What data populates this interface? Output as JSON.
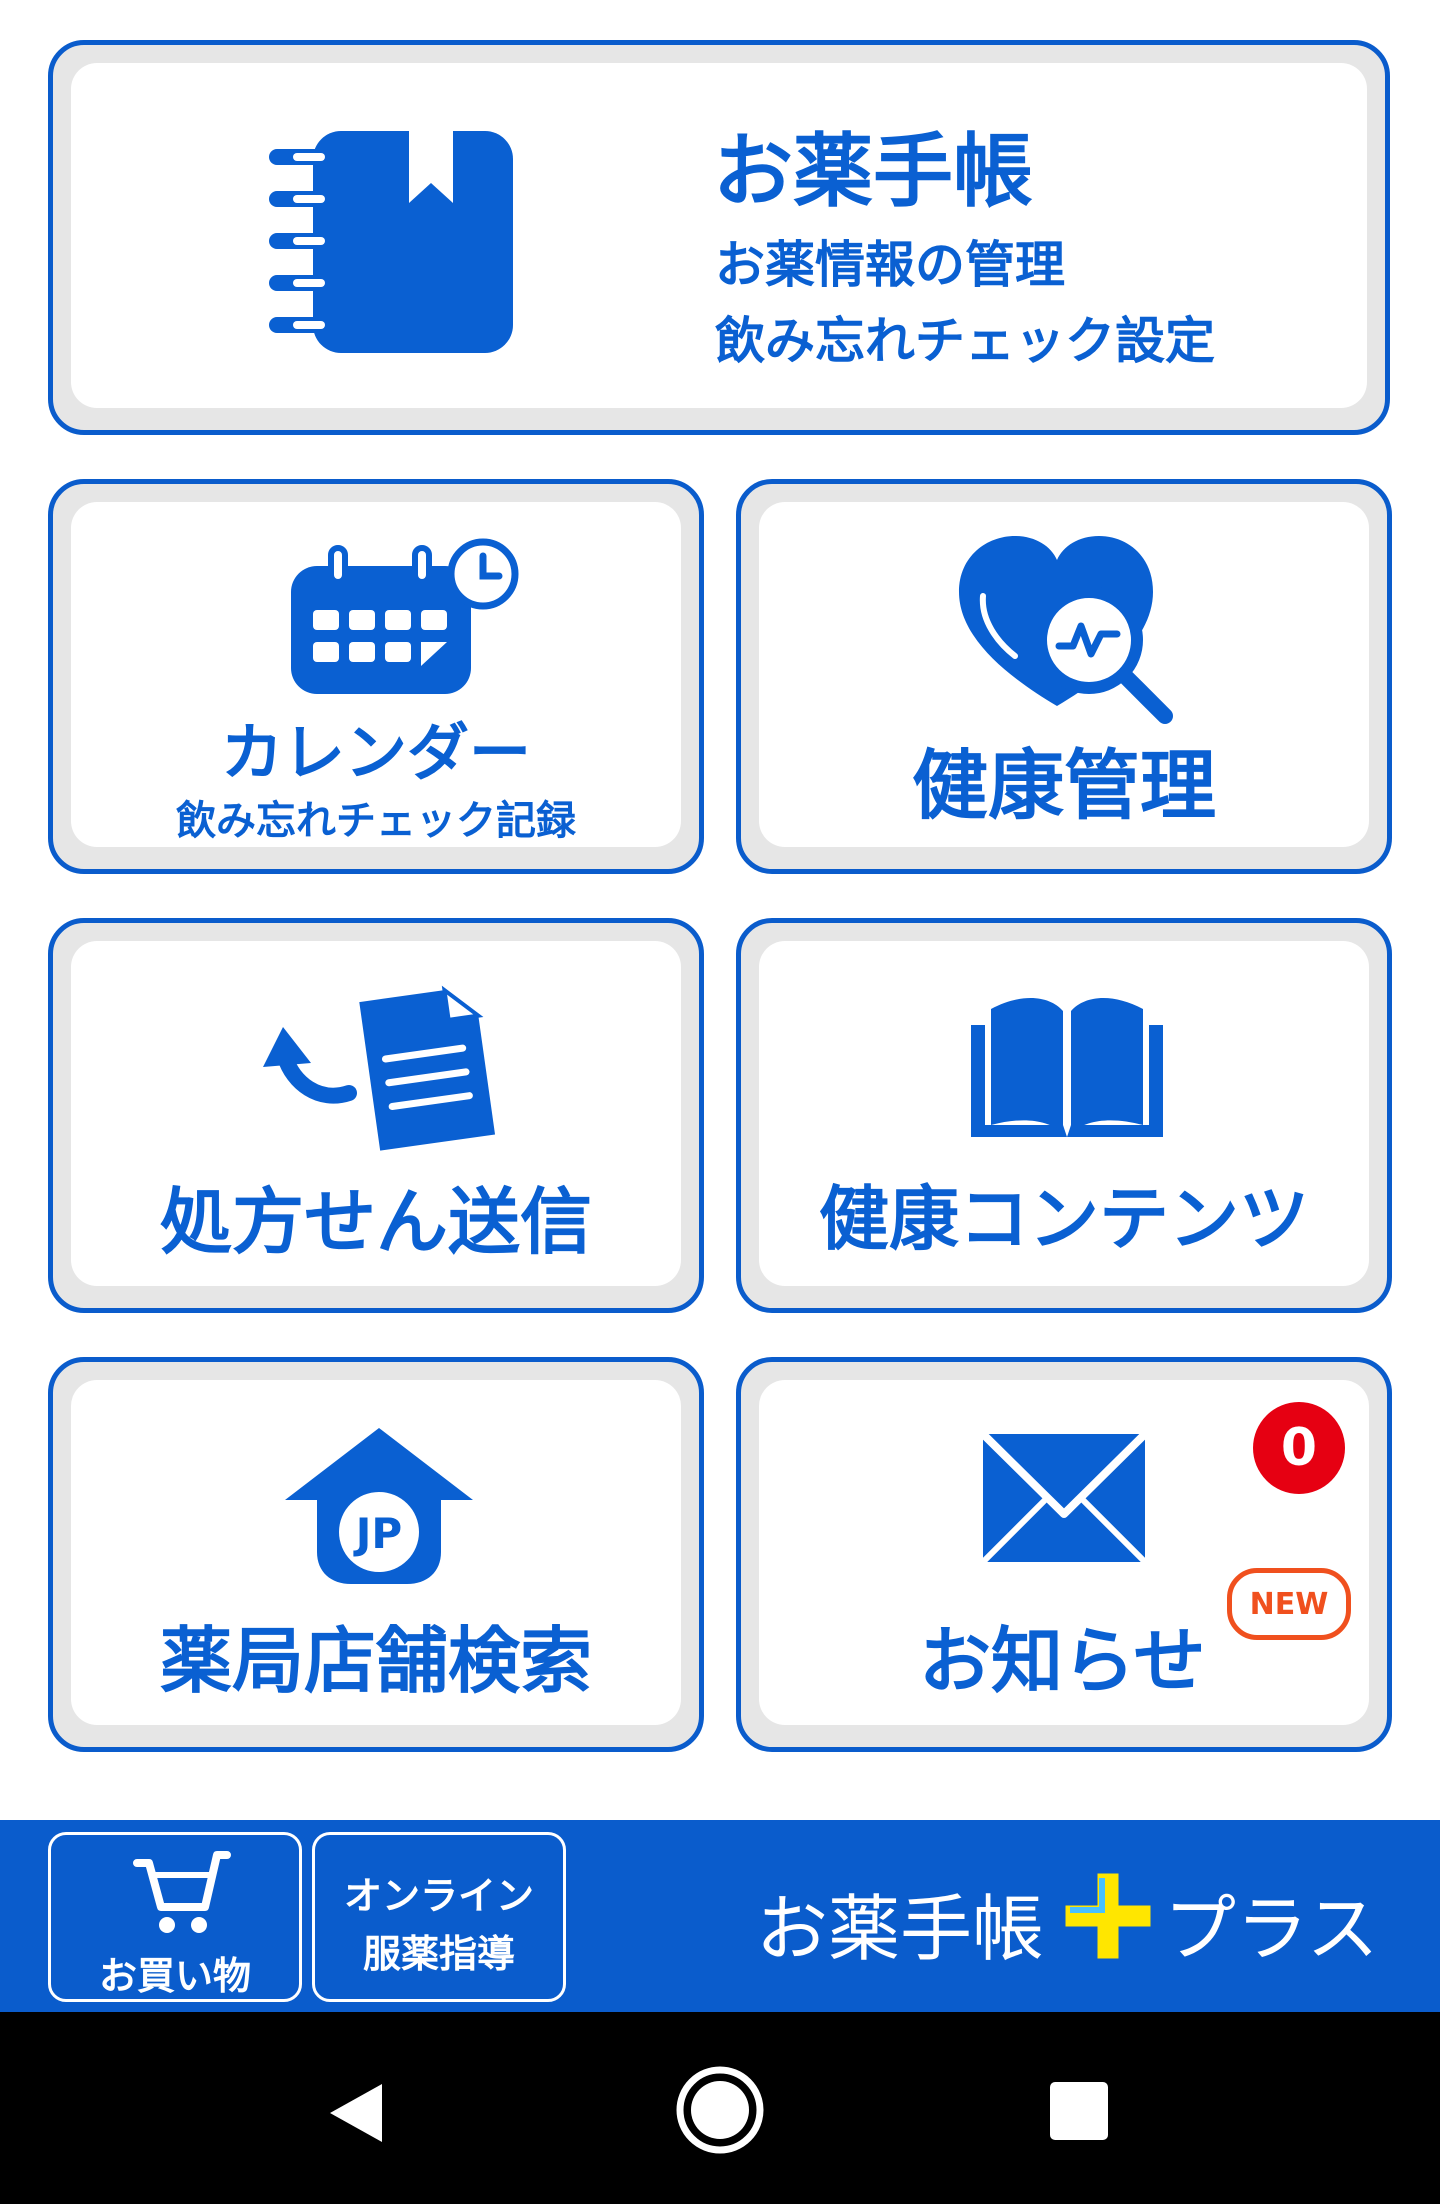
{
  "tiles": {
    "notebook": {
      "title": "お薬手帳",
      "line1": "お薬情報の管理",
      "line2": "飲み忘れチェック設定"
    },
    "calendar": {
      "title": "カレンダー",
      "subtitle": "飲み忘れチェック記録"
    },
    "health": {
      "title": "健康管理"
    },
    "prescription": {
      "title": "処方せん送信"
    },
    "contents": {
      "title": "健康コンテンツ"
    },
    "pharmacy": {
      "title": "薬局店舗検索"
    },
    "notice": {
      "title": "お知らせ",
      "badge_count": "0",
      "new_label": "NEW"
    }
  },
  "footer": {
    "shopping_label": "お買い物",
    "online_line1": "オンライン",
    "online_line2": "服薬指導",
    "brand_main": "お薬手帳",
    "brand_suffix": "プラス"
  },
  "icons": {
    "notebook": "notebook-icon",
    "calendar": "calendar-clock-icon",
    "health": "heart-magnifier-icon",
    "prescription": "document-send-icon",
    "contents": "open-book-icon",
    "pharmacy": "pharmacy-house-icon",
    "notice": "envelope-icon",
    "cart": "cart-icon",
    "plus": "plus-icon"
  },
  "colors": {
    "primary": "#0a5ccc",
    "badge": "#e60012",
    "new_tag": "#f0501e",
    "plus_yellow": "#ffe600"
  }
}
